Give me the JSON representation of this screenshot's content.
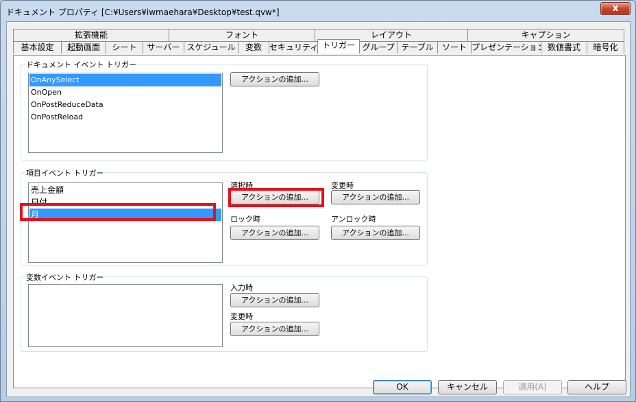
{
  "window": {
    "title": "ドキュメント プロパティ [C:¥Users¥iwmaehara¥Desktop¥test.qvw*]",
    "close_symbol": "x"
  },
  "tabs": {
    "row_top": [
      "拡張機能",
      "フォント",
      "レイアウト",
      "キャプション"
    ],
    "row_bottom": [
      "基本設定",
      "起動画面",
      "シート",
      "サーバー",
      "スケジュール",
      "変数",
      "セキュリティ",
      "トリガー",
      "グループ",
      "テーブル",
      "ソート",
      "プレゼンテーション",
      "数値書式",
      "暗号化"
    ],
    "active": "トリガー"
  },
  "document_triggers": {
    "label": "ドキュメント イベント トリガー",
    "items": [
      "OnAnySelect",
      "OnOpen",
      "OnPostReduceData",
      "OnPostReload"
    ],
    "selected": "OnAnySelect",
    "add_action": "アクションの追加..."
  },
  "field_triggers": {
    "label": "項目イベント トリガー",
    "items": [
      "売上金額",
      "日付",
      "月"
    ],
    "selected": "月",
    "select_label": "選択時",
    "change_label": "変更時",
    "lock_label": "ロック時",
    "unlock_label": "アンロック時",
    "add_action": "アクションの追加..."
  },
  "variable_triggers": {
    "label": "変数イベント トリガー",
    "items": [],
    "input_label": "入力時",
    "change_label": "変更時",
    "add_action": "アクションの追加..."
  },
  "footer": {
    "ok": "OK",
    "cancel": "キャンセル",
    "apply": "適用(A)",
    "help": "ヘルプ"
  },
  "colors": {
    "highlight": "#e8101b",
    "selection": "#3399ff"
  }
}
